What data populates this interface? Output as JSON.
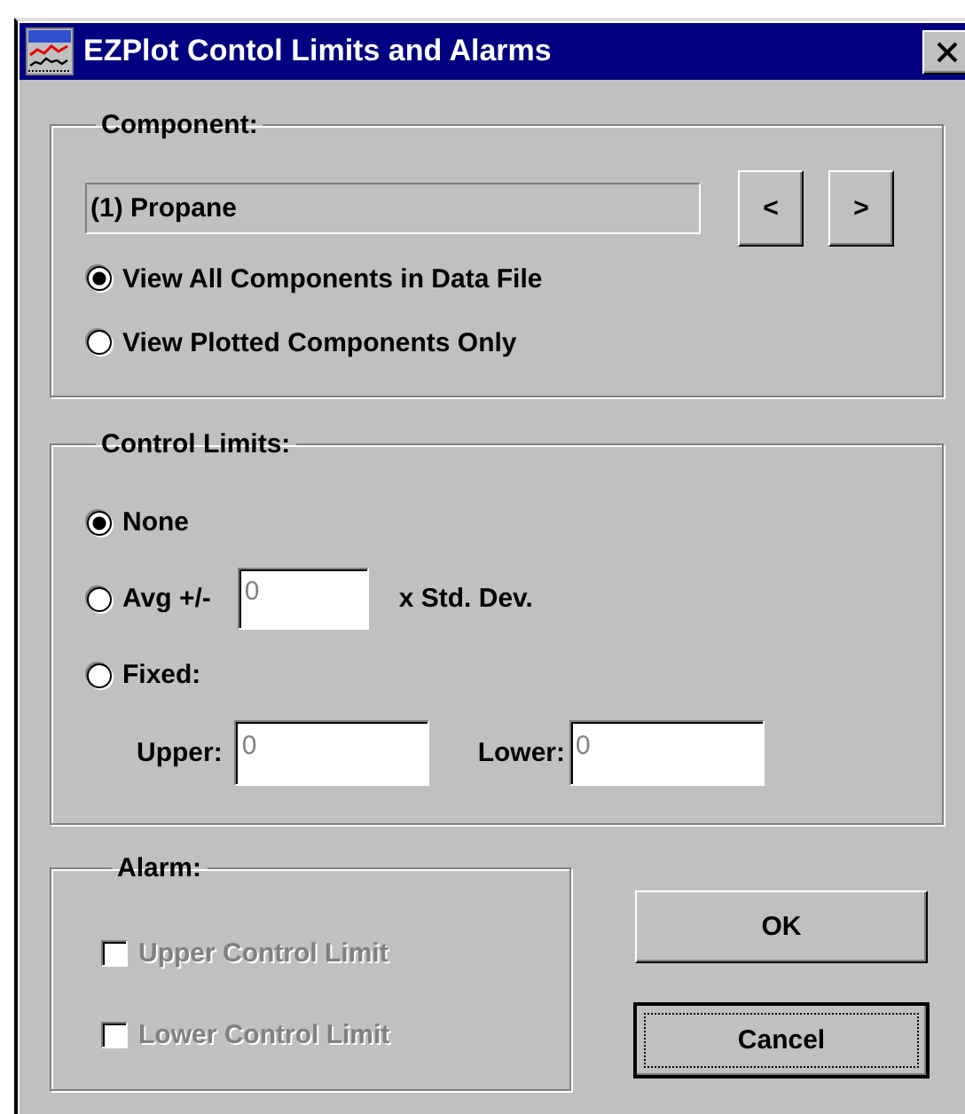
{
  "window": {
    "title": "EZPlot Contol Limits and Alarms"
  },
  "component": {
    "label": "Component:",
    "value": "(1) Propane",
    "prev": "<",
    "next": ">",
    "options": [
      {
        "label": "View All Components in Data File",
        "selected": true
      },
      {
        "label": "View Plotted Components Only",
        "selected": false
      }
    ]
  },
  "control_limits": {
    "label": "Control Limits:",
    "options": [
      {
        "kind": "plain",
        "label": "None",
        "selected": true
      },
      {
        "kind": "factor",
        "label": "Avg +/-",
        "value": "0",
        "disabled": true,
        "suffix": "x Std. Dev.",
        "selected": false
      },
      {
        "kind": "fixed",
        "label": "Fixed:",
        "selected": false,
        "fields": [
          {
            "label": "Upper:",
            "value": "0",
            "disabled": true
          },
          {
            "label": "Lower:",
            "value": "0",
            "disabled": true
          }
        ]
      }
    ]
  },
  "alarm": {
    "label": "Alarm:",
    "items": [
      {
        "label": "Upper Control Limit",
        "checked": false,
        "disabled": true
      },
      {
        "label": "Lower Control Limit",
        "checked": false,
        "disabled": true
      }
    ]
  },
  "buttons": [
    {
      "label": "OK",
      "default": false
    },
    {
      "label": "Cancel",
      "default": true
    }
  ]
}
